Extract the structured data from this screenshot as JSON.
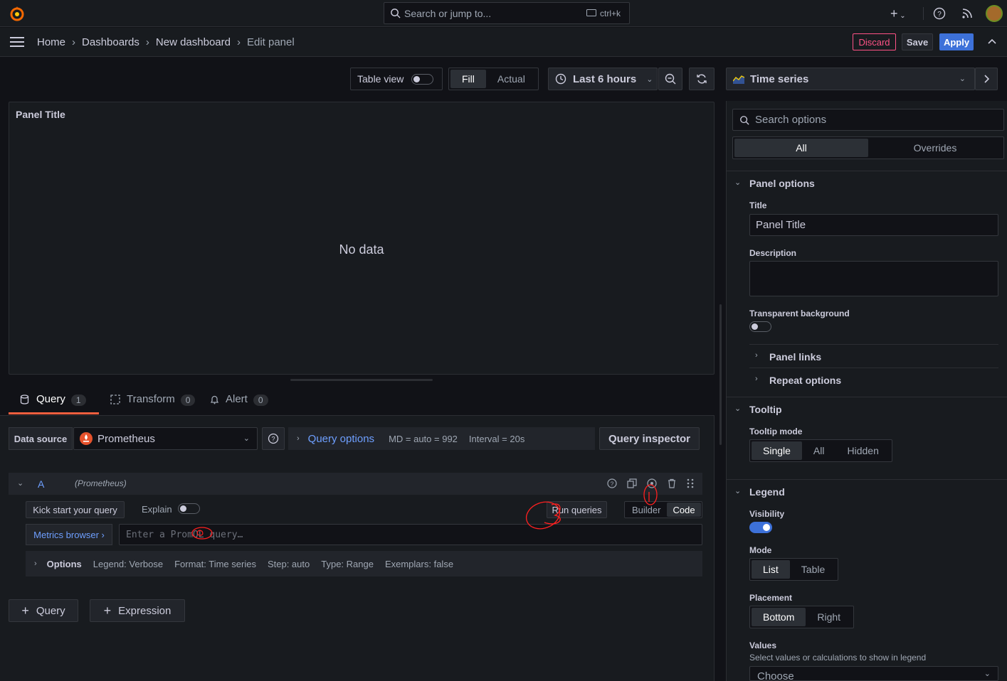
{
  "topbar": {
    "search_placeholder": "Search or jump to...",
    "search_shortcut": "ctrl+k"
  },
  "breadcrumb": {
    "home": "Home",
    "dashboards": "Dashboards",
    "new_dashboard": "New dashboard",
    "current": "Edit panel"
  },
  "actions": {
    "discard": "Discard",
    "save": "Save",
    "apply": "Apply"
  },
  "toolbar": {
    "table_view": "Table view",
    "fill": "Fill",
    "actual": "Actual",
    "time_range": "Last 6 hours"
  },
  "viz_picker": {
    "label": "Time series"
  },
  "panel": {
    "title": "Panel Title",
    "empty": "No data"
  },
  "tabs": [
    {
      "label": "Query",
      "count": "1"
    },
    {
      "label": "Transform",
      "count": "0"
    },
    {
      "label": "Alert",
      "count": "0"
    }
  ],
  "query": {
    "datasource_label": "Data source",
    "datasource": "Prometheus",
    "query_options": "Query options",
    "md": "MD = auto = 992",
    "interval": "Interval = 20s",
    "inspector": "Query inspector",
    "row_letter": "A",
    "row_ds": "(Prometheus)",
    "kickstart": "Kick start your query",
    "explain": "Explain",
    "run": "Run queries",
    "builder": "Builder",
    "code": "Code",
    "metrics_browser": "Metrics browser ›",
    "editor_placeholder": "Enter a PromQL query…",
    "options_label": "Options",
    "opt_legend": "Legend: Verbose",
    "opt_format": "Format: Time series",
    "opt_step": "Step: auto",
    "opt_type": "Type: Range",
    "opt_exemplars": "Exemplars: false",
    "add_query": "Query",
    "add_expression": "Expression"
  },
  "options_pane": {
    "search_placeholder": "Search options",
    "tab_all": "All",
    "tab_overrides": "Overrides",
    "panel_options": "Panel options",
    "title_label": "Title",
    "title_value": "Panel Title",
    "description_label": "Description",
    "transparent_label": "Transparent background",
    "panel_links": "Panel links",
    "repeat_options": "Repeat options",
    "tooltip": "Tooltip",
    "tooltip_mode": "Tooltip mode",
    "tooltip_modes": [
      "Single",
      "All",
      "Hidden"
    ],
    "legend": "Legend",
    "visibility": "Visibility",
    "mode": "Mode",
    "modes": [
      "List",
      "Table"
    ],
    "placement": "Placement",
    "placements": [
      "Bottom",
      "Right"
    ],
    "values": "Values",
    "values_desc": "Select values or calculations to show in legend",
    "values_placeholder": "Choose"
  },
  "colors": {
    "accent": "#3d71d9",
    "brand": "#f46800",
    "danger": "#ff5286",
    "tab_underline": "#f55f3e"
  }
}
